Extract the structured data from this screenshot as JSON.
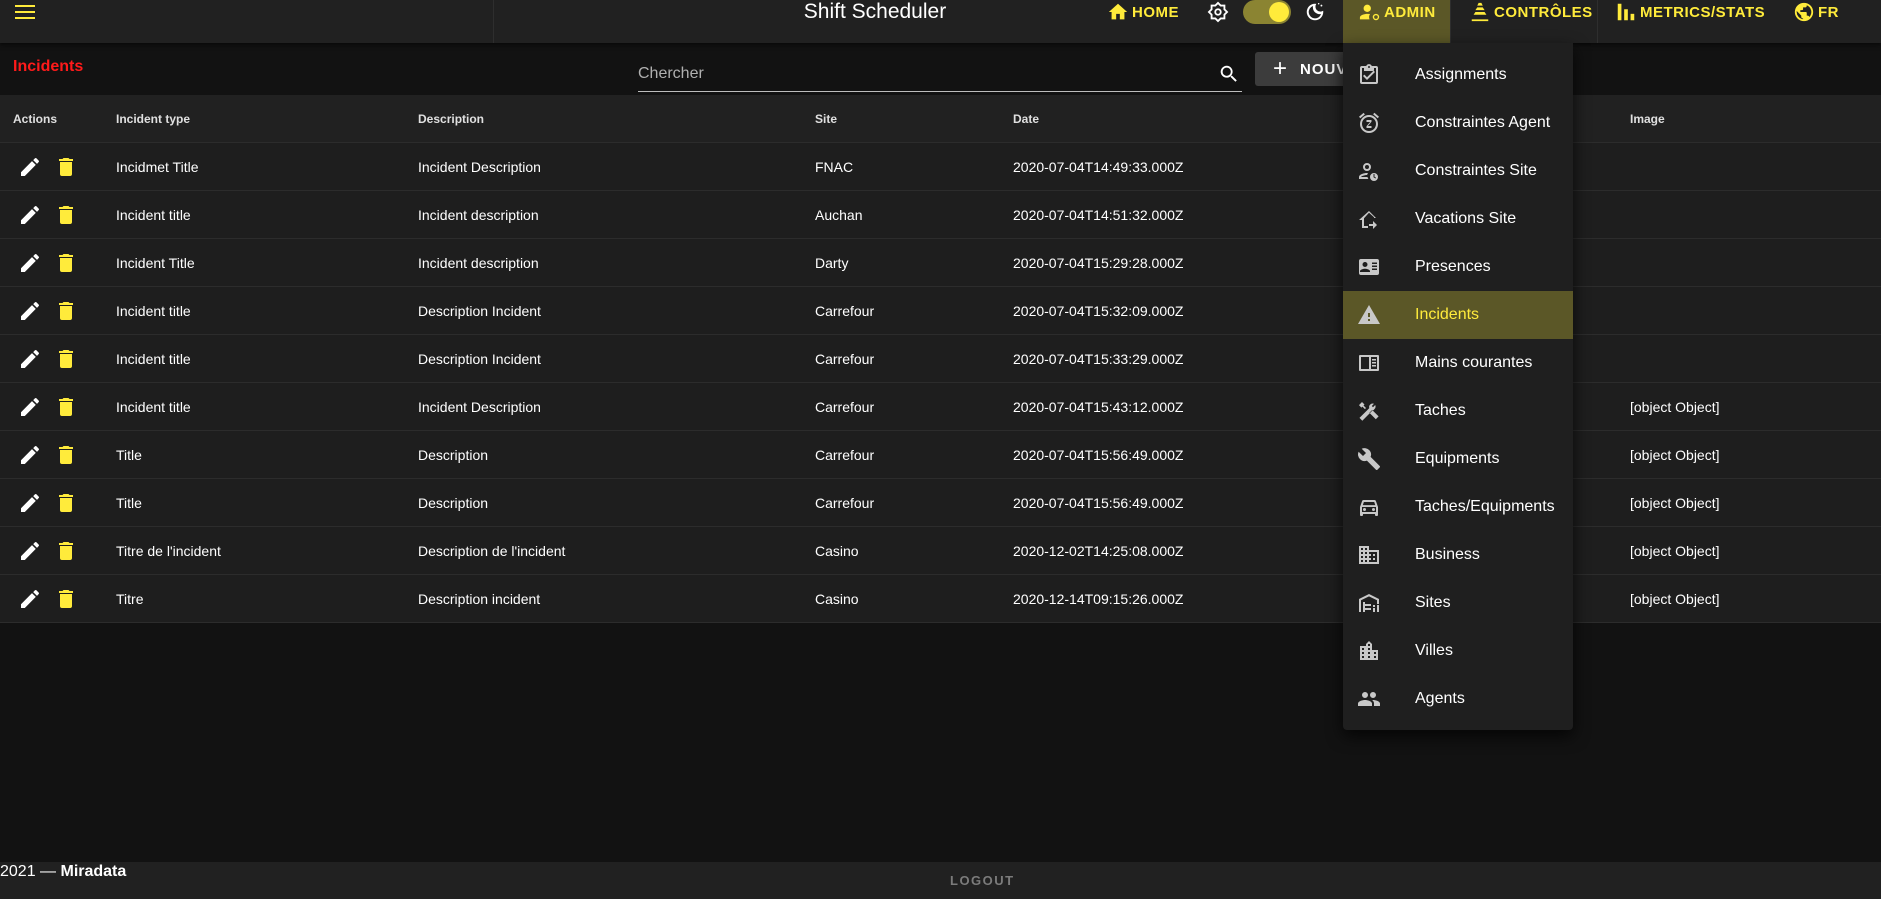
{
  "app": {
    "title": "Shift Scheduler"
  },
  "nav": {
    "home_label": "HOME",
    "admin_label": "ADMIN",
    "controles_label": "CONTRÔLES",
    "metrics_label": "METRICS/STATS",
    "lang_label": "FR",
    "theme_toggle_on": true
  },
  "page": {
    "title": "Incidents",
    "search_placeholder": "Chercher",
    "new_button_label": "NOUV"
  },
  "table": {
    "headers": {
      "actions": "Actions",
      "incident_type": "Incident type",
      "description": "Description",
      "site": "Site",
      "date": "Date",
      "image": "Image"
    },
    "rows": [
      {
        "type": "Incidmet Title",
        "description": "Incident Description",
        "site": "FNAC",
        "date": "2020-07-04T14:49:33.000Z",
        "image": ""
      },
      {
        "type": "Incident title",
        "description": "Incident description",
        "site": "Auchan",
        "date": "2020-07-04T14:51:32.000Z",
        "image": ""
      },
      {
        "type": "Incident Title",
        "description": "Incident description",
        "site": "Darty",
        "date": "2020-07-04T15:29:28.000Z",
        "image": ""
      },
      {
        "type": "Incident title",
        "description": "Description Incident",
        "site": "Carrefour",
        "date": "2020-07-04T15:32:09.000Z",
        "image": ""
      },
      {
        "type": "Incident title",
        "description": "Description Incident",
        "site": "Carrefour",
        "date": "2020-07-04T15:33:29.000Z",
        "image": ""
      },
      {
        "type": "Incident title",
        "description": "Incident Description",
        "site": "Carrefour",
        "date": "2020-07-04T15:43:12.000Z",
        "image": "[object Object]"
      },
      {
        "type": "Title",
        "description": "Description",
        "site": "Carrefour",
        "date": "2020-07-04T15:56:49.000Z",
        "image": "[object Object]"
      },
      {
        "type": "Title",
        "description": "Description",
        "site": "Carrefour",
        "date": "2020-07-04T15:56:49.000Z",
        "image": "[object Object]"
      },
      {
        "type": "Titre de l'incident",
        "description": "Description de l'incident",
        "site": "Casino",
        "date": "2020-12-02T14:25:08.000Z",
        "image": "[object Object]"
      },
      {
        "type": "Titre",
        "description": "Description incident",
        "site": "Casino",
        "date": "2020-12-14T09:15:26.000Z",
        "image": "[object Object]"
      }
    ]
  },
  "admin_menu": {
    "items": [
      {
        "label": "Assignments",
        "icon": "assignment-check-icon",
        "active": false
      },
      {
        "label": "Constraintes Agent",
        "icon": "alarm-icon",
        "active": false
      },
      {
        "label": "Constraintes Site",
        "icon": "person-clock-icon",
        "active": false
      },
      {
        "label": "Vacations Site",
        "icon": "home-arrow-icon",
        "active": false
      },
      {
        "label": "Presences",
        "icon": "id-card-icon",
        "active": false
      },
      {
        "label": "Incidents",
        "icon": "warning-icon",
        "active": true
      },
      {
        "label": "Mains courantes",
        "icon": "logbook-icon",
        "active": false
      },
      {
        "label": "Taches",
        "icon": "tools-icon",
        "active": false
      },
      {
        "label": "Equipments",
        "icon": "wrench-icon",
        "active": false
      },
      {
        "label": "Taches/Equipments",
        "icon": "car-icon",
        "active": false
      },
      {
        "label": "Business",
        "icon": "business-icon",
        "active": false
      },
      {
        "label": "Sites",
        "icon": "garage-icon",
        "active": false
      },
      {
        "label": "Villes",
        "icon": "city-icon",
        "active": false
      },
      {
        "label": "Agents",
        "icon": "people-icon",
        "active": false
      }
    ]
  },
  "footer": {
    "copyright_prefix": "2021 — ",
    "company": "Miradata",
    "logout_label": "LOGOUT"
  },
  "colors": {
    "accent": "#ffeb3b",
    "active_bg": "#5b5727",
    "title_red": "#ff1a1a",
    "bar": "#212121",
    "background": "#121212"
  }
}
